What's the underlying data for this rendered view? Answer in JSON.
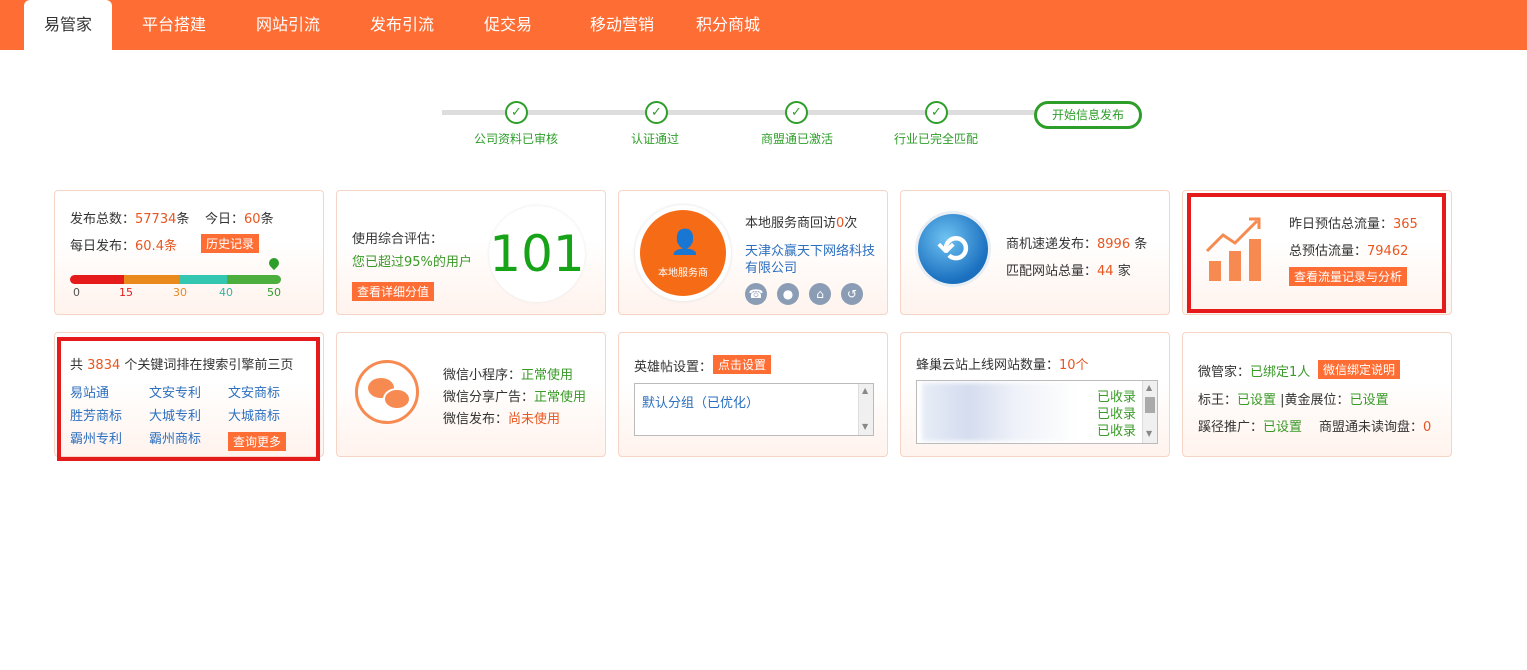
{
  "nav": {
    "tabs": [
      "易管家",
      "平台搭建",
      "网站引流",
      "发布引流",
      "促交易",
      "移动营销",
      "积分商城"
    ]
  },
  "steps": {
    "items": [
      "公司资料已审核",
      "认证通过",
      "商盟通已激活",
      "行业已完全匹配"
    ],
    "final": "开始信息发布"
  },
  "publish": {
    "total_label": "发布总数：",
    "total_value": "57734",
    "total_unit": "条",
    "today_label": "今日：",
    "today_value": "60",
    "today_unit": "条",
    "daily_label": "每日发布：",
    "daily_value": "60.4条",
    "history_btn": "历史记录",
    "scale": [
      "0",
      "15",
      "30",
      "40",
      "50"
    ]
  },
  "score": {
    "label": "使用综合评估：",
    "desc": "您已超过95%的用户",
    "value": "101",
    "detail_btn": "查看详细分值"
  },
  "service": {
    "badge": "本地服务商",
    "visit_prefix": "本地服务商回访",
    "visit_count": "0",
    "visit_suffix": "次",
    "company_line1": "天津众赢天下网络科技",
    "company_line2": "有限公司"
  },
  "shangji": {
    "speed_label": "商机速递发布：",
    "speed_value": "8996",
    "speed_unit": "条",
    "match_label": "匹配网站总量：",
    "match_value": "44",
    "match_unit": "家"
  },
  "traffic": {
    "yesterday_label": "昨日预估总流量：",
    "yesterday_value": "365",
    "total_label": "总预估流量：",
    "total_value": "79462",
    "btn": "查看流量记录与分析"
  },
  "keywords": {
    "prefix": "共",
    "count": "3834",
    "suffix": "个关键词排在搜索引擎前三页",
    "links": [
      "易站通",
      "文安专利",
      "文安商标",
      "胜芳商标",
      "大城专利",
      "大城商标",
      "霸州专利",
      "霸州商标"
    ],
    "more_btn": "查询更多"
  },
  "wechat": {
    "mini_label": "微信小程序：",
    "mini_status": "正常使用",
    "share_label": "微信分享广告：",
    "share_status": "正常使用",
    "publish_label": "微信发布：",
    "publish_status": "尚未使用"
  },
  "hero": {
    "label": "英雄帖设置：",
    "btn": "点击设置",
    "group": "默认分组（已优化）"
  },
  "sites": {
    "label": "蜂巢云站上线网站数量：",
    "count": "10个",
    "status": [
      "已收录",
      "已收录",
      "已收录"
    ]
  },
  "butler": {
    "wgj_label": "微管家：",
    "wgj_value": "已绑定1人",
    "wgj_btn": "微信绑定说明",
    "biaowang_label": "标王：",
    "biaowang_value": "已设置",
    "gold_label": "|黄金展位：",
    "gold_value": "已设置",
    "path_label": "蹊径推广：",
    "path_value": "已设置",
    "unread_label": "商盟通未读询盘：",
    "unread_value": "0"
  },
  "colors": {
    "accent": "#fe6d34",
    "green": "#2e9e2a",
    "highlight": "#e51b1b"
  }
}
